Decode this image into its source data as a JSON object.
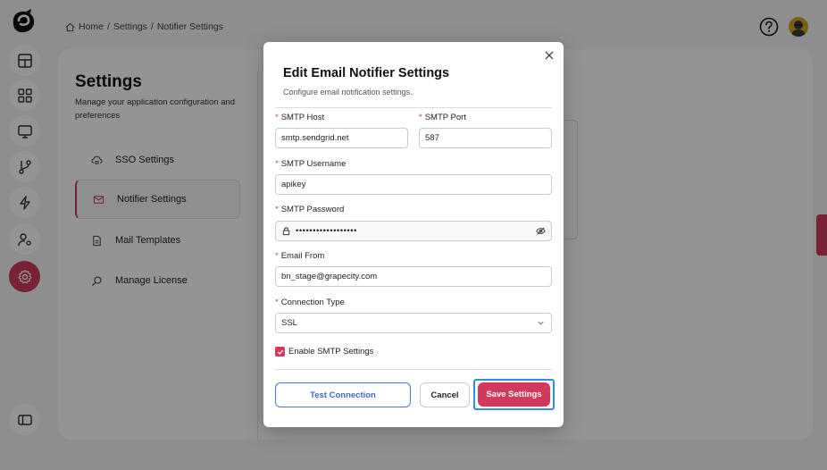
{
  "breadcrumb": {
    "home": "Home",
    "sep1": "/",
    "settings": "Settings",
    "sep2": "/",
    "current": "Notifier Settings"
  },
  "rail": {
    "items": [
      {
        "name": "dashboard-icon",
        "active": false
      },
      {
        "name": "apps-icon",
        "active": false
      },
      {
        "name": "monitor-icon",
        "active": false
      },
      {
        "name": "git-branch-icon",
        "active": false
      },
      {
        "name": "lightning-icon",
        "active": false
      },
      {
        "name": "user-settings-icon",
        "active": false
      },
      {
        "name": "gear-icon",
        "active": true
      }
    ],
    "accent": "#d13a5c"
  },
  "settings": {
    "title": "Settings",
    "description": "Manage your application configuration and preferences",
    "menu": [
      {
        "label": "SSO Settings",
        "icon": "cloud-lock-icon"
      },
      {
        "label": "Notifier Settings",
        "icon": "mail-icon",
        "active": true
      },
      {
        "label": "Mail Templates",
        "icon": "document-icon"
      },
      {
        "label": "Manage License",
        "icon": "key-search-icon"
      }
    ]
  },
  "modal": {
    "title": "Edit Email Notifier Settings",
    "subtitle": "Configure email notification settings.",
    "required_mark": "*",
    "smtp_host": {
      "label": "SMTP Host",
      "value": "smtp.sendgrid.net"
    },
    "smtp_port": {
      "label": "SMTP Port",
      "value": "587"
    },
    "smtp_username": {
      "label": "SMTP Username",
      "value": "apikey"
    },
    "smtp_password": {
      "label": "SMTP Password",
      "value": "••••••••••••••••••"
    },
    "email_from": {
      "label": "Email From",
      "value": "bn_stage@grapecity.com"
    },
    "connection_type": {
      "label": "Connection Type",
      "value": "SSL"
    },
    "enable_smtp": {
      "label": "Enable SMTP Settings",
      "checked": true
    },
    "buttons": {
      "test": "Test Connection",
      "cancel": "Cancel",
      "save": "Save Settings"
    }
  },
  "colors": {
    "accent": "#d13a5c",
    "link_blue": "#3c6ac8",
    "focus_blue": "#2f8fe0"
  }
}
